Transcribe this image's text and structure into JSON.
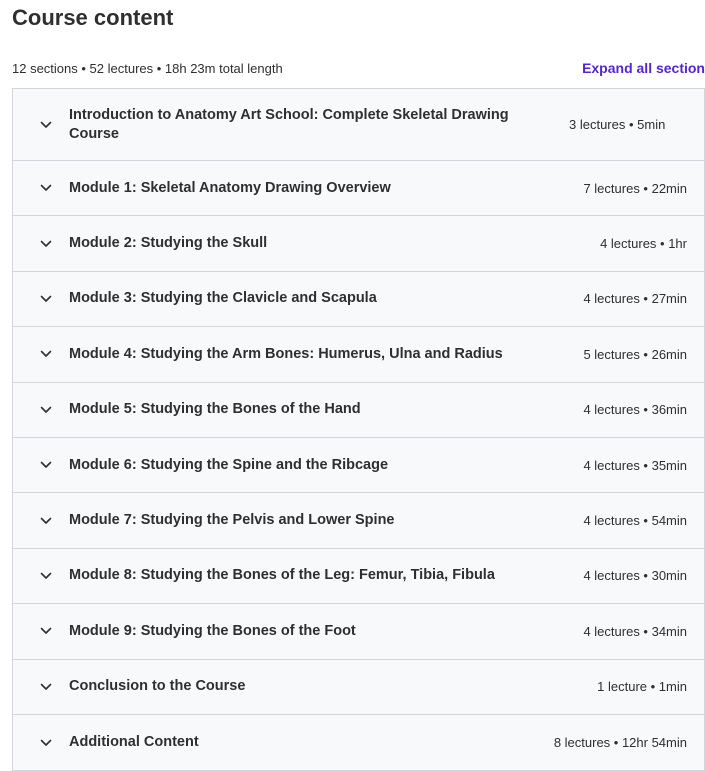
{
  "header": {
    "title": "Course content",
    "summary": "12 sections • 52 lectures • 18h 23m total length",
    "expand_all_label": "Expand all section"
  },
  "sections": [
    {
      "title": "Introduction to Anatomy Art School: Complete Skeletal Drawing Course",
      "info": "3 lectures • 5min"
    },
    {
      "title": "Module 1: Skeletal Anatomy Drawing Overview",
      "info": "7 lectures • 22min"
    },
    {
      "title": "Module 2: Studying the Skull",
      "info": "4 lectures • 1hr"
    },
    {
      "title": "Module 3: Studying the Clavicle and Scapula",
      "info": "4 lectures • 27min"
    },
    {
      "title": "Module 4: Studying the Arm Bones: Humerus, Ulna and Radius",
      "info": "5 lectures • 26min"
    },
    {
      "title": "Module 5: Studying the Bones of the Hand",
      "info": "4 lectures • 36min"
    },
    {
      "title": "Module 6: Studying the Spine and the Ribcage",
      "info": "4 lectures • 35min"
    },
    {
      "title": "Module 7: Studying the Pelvis and Lower Spine",
      "info": "4 lectures • 54min"
    },
    {
      "title": "Module 8: Studying the Bones of the Leg: Femur, Tibia, Fibula",
      "info": "4 lectures • 30min"
    },
    {
      "title": "Module 9: Studying the Bones of the Foot",
      "info": "4 lectures • 34min"
    },
    {
      "title": "Conclusion to the Course",
      "info": "1 lecture • 1min"
    },
    {
      "title": "Additional Content",
      "info": "8 lectures • 12hr 54min"
    }
  ],
  "icons": {
    "section_toggle": "chevron-down-icon"
  },
  "colors": {
    "accent": "#5624d0",
    "text": "#2d2f31",
    "section_bg": "#f7f9fa",
    "border": "#d1d7dc"
  }
}
